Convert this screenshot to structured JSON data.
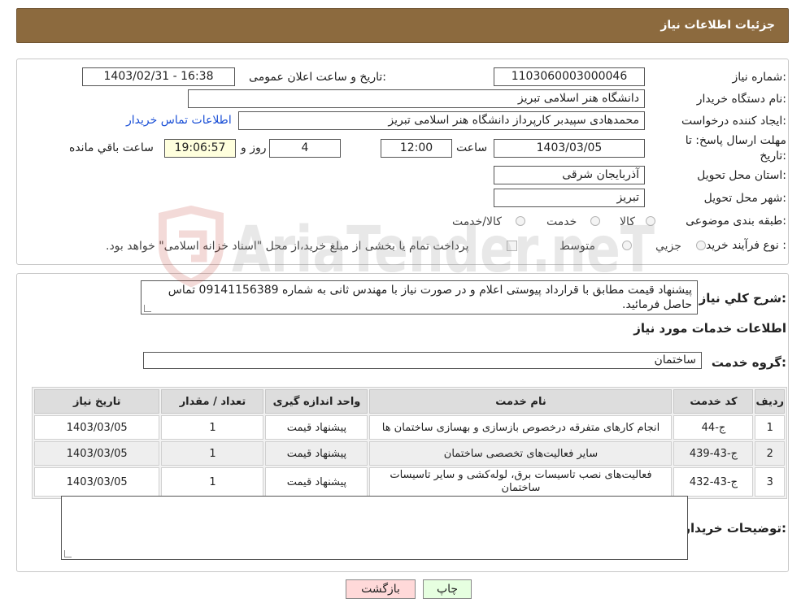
{
  "header": {
    "title": "جزئیات اطلاعات نیاز"
  },
  "form": {
    "need_number": {
      "label": "شماره نیاز:",
      "value": "1103060003000046"
    },
    "announce": {
      "label": "تاریخ و ساعت اعلان عمومی:",
      "value": "1403/02/31 - 16:38"
    },
    "buyer_org": {
      "label": "نام دستگاه خریدار:",
      "value": "دانشگاه هنر اسلامی تبریز"
    },
    "requester": {
      "label": "ایجاد کننده درخواست:",
      "value": "محمدهادی سپیدبر کارپرداز دانشگاه هنر اسلامی تبریز",
      "contact_link": "اطلاعات تماس خریدار"
    },
    "deadline": {
      "label": "مهلت ارسال پاسخ: تا تاریخ:",
      "date": "1403/03/05",
      "time_label": "ساعت",
      "time": "12:00",
      "days": "4",
      "days_label": "روز و",
      "remaining": "19:06:57",
      "remaining_label": "ساعت باقي مانده"
    },
    "province": {
      "label": "استان محل تحویل:",
      "value": "آذربایجان شرقی"
    },
    "city": {
      "label": "شهر محل تحویل:",
      "value": "تبریز"
    },
    "category": {
      "label": "طبقه بندی موضوعی:",
      "options": [
        "کالا",
        "خدمت",
        "کالا/خدمت"
      ]
    },
    "purchase_type": {
      "label": "نوع فرآیند خرید :",
      "options": [
        "جزیي",
        "متوسط"
      ],
      "note": "پرداخت تمام یا بخشی از مبلغ خرید،از محل \"اسناد خزانه اسلامی\" خواهد بود."
    }
  },
  "description": {
    "label": "شرح کلي نياز:",
    "text": "پیشنهاد قیمت مطابق با قرارداد پیوستی اعلام و در صورت نیاز با مهندس ثانی به شماره 09141156389 تماس حاصل فرمائید."
  },
  "services_section": {
    "title": "اطلاعات خدمات مورد نياز"
  },
  "service_group": {
    "label": "گروه خدمت:",
    "value": "ساختمان"
  },
  "table": {
    "headers": [
      "ردیف",
      "کد خدمت",
      "نام خدمت",
      "واحد اندازه گیری",
      "تعداد / مقدار",
      "تاریخ نیاز"
    ],
    "rows": [
      [
        "1",
        "ج-44",
        "انجام کارهای متفرقه درخصوص بازسازی و بهسازی ساختمان ها",
        "پیشنهاد قیمت",
        "1",
        "1403/03/05"
      ],
      [
        "2",
        "ج-43-439",
        "سایر فعالیت‌های تخصصی ساختمان",
        "پیشنهاد قیمت",
        "1",
        "1403/03/05"
      ],
      [
        "3",
        "ج-43-432",
        "فعالیت‌های نصب تاسیسات برق، لوله‌کشی و سایر تاسیسات ساختمان",
        "پیشنهاد قیمت",
        "1",
        "1403/03/05"
      ]
    ]
  },
  "buyer_notes": {
    "label": "توضیحات خریدار:",
    "value": ""
  },
  "buttons": {
    "print": "چاپ",
    "back": "بازگشت"
  },
  "watermark": {
    "text": "AriaTender.neT"
  },
  "colors": {
    "header_bg": "#8c6a3e",
    "link": "#1a4fd6",
    "back_button": "#ffd9d9",
    "print_button": "#e6ffe0"
  }
}
